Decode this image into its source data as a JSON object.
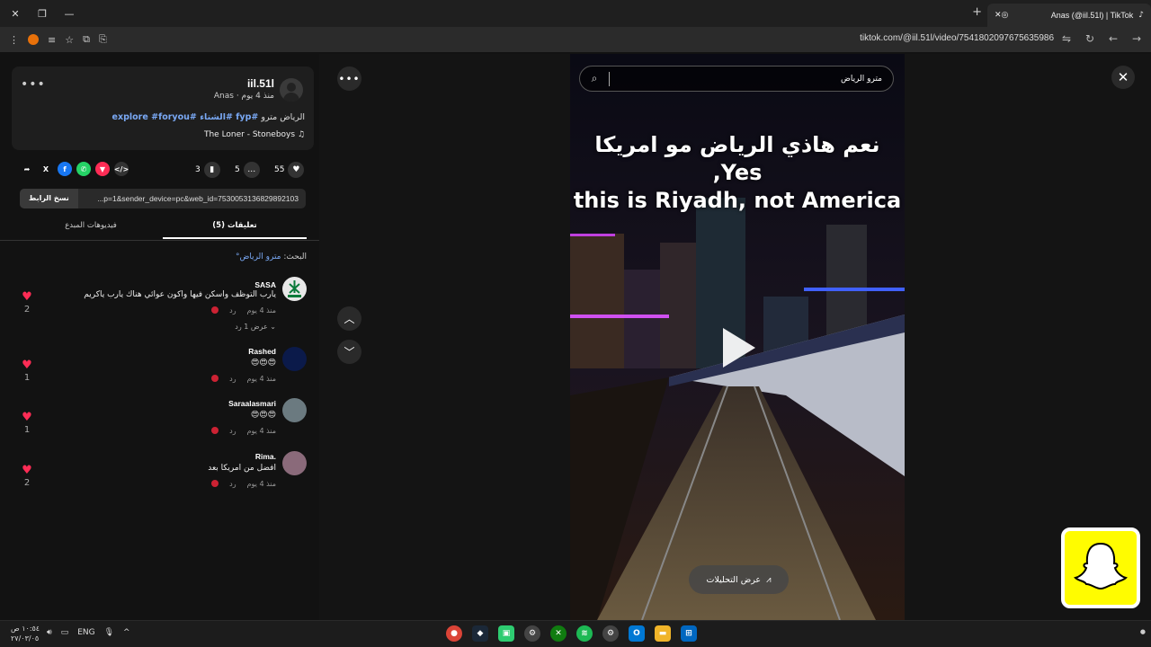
{
  "browser": {
    "tab_title": "Anas (@iil.51l) | TikTok",
    "url": "tiktok.com/@iil.51l/video/7541802097675635986"
  },
  "post": {
    "username": "iil.51l",
    "meta": "Anas · منذ 4 يوم",
    "caption_prefix": "الرياض مترو",
    "hashtags": "#fyp #الشتاء #explore #foryou",
    "music": "The Loner - Stoneboys ♫",
    "likes": "55",
    "comments": "5",
    "saves": "3",
    "copy_label": "نسخ الرابط",
    "link": "...p=1&sender_device=pc&web_id=7530053136829892103"
  },
  "tabs": {
    "comments": "(5) تعليقات",
    "creator_videos": "فيديوهات المبدع"
  },
  "search_hint": {
    "prefix": "البحث:",
    "query": "مترو الرياض"
  },
  "comments": [
    {
      "name": "SASA",
      "text": "يارب التوظف واسكن فيها واكون عوائي هناك يارب ياكريم",
      "time": "منذ 4 يوم",
      "reply": "رد",
      "likes": "2",
      "replies": "عرض 1 رد"
    },
    {
      "name": "Rashed",
      "text": "😍😍😍",
      "time": "منذ 4 يوم",
      "reply": "رد",
      "likes": "1"
    },
    {
      "name": "Saraalasmari",
      "text": "😍😍😍",
      "time": "منذ 4 يوم",
      "reply": "رد",
      "likes": "1"
    },
    {
      "name": "Rima.",
      "text": "افضل من امريكا بعد",
      "time": "منذ 4 يوم",
      "reply": "رد",
      "likes": "2"
    }
  ],
  "video": {
    "search_value": "مترو الرياض",
    "overlay_line1": "نعم هاذي الرياض مو امريكا ,Yes",
    "overlay_line2": "this is Riyadh, not America",
    "analytics_label": "عرض التحليلات"
  },
  "taskbar": {
    "time": "١٠:٥٤ ص",
    "date": "٢٧/٠٣/٠٥",
    "lang": "ENG"
  },
  "colors": {
    "accent_red": "#fe2c55",
    "hashtag_blue": "#7aa9f5",
    "snap_yellow": "#fffc00"
  }
}
